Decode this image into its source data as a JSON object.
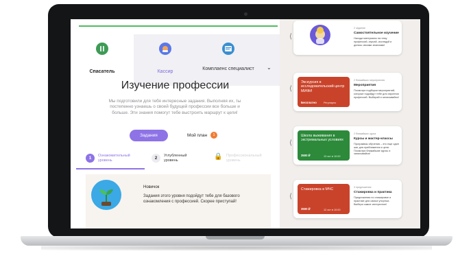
{
  "tabs": [
    {
      "label": "Спасатель",
      "icon": "lifeguard-icon",
      "color": "#3e9b56"
    },
    {
      "label": "Кассир",
      "icon": "cashier-icon",
      "color": "#5a78e8"
    },
    {
      "label": "Комплаенс специалист",
      "icon": "compliance-icon",
      "color": "#3a8fd0"
    }
  ],
  "main": {
    "title": "Изучение профессии",
    "description": "Мы подготовили для тебя интересные задания. Выполняя их, ты постепенно узнаешь о своей будущей профессии все больше и больше. Эти знания помогут тебе выстроить маршрут к цели!",
    "tasks_button": "Задания",
    "my_plan": "Мой план",
    "plan_count": "1"
  },
  "levels": [
    {
      "num": "1",
      "label": "Ознакомительный уровень"
    },
    {
      "num": "2",
      "label": "Углубленный уровень"
    },
    {
      "label": "Профессиональный уровень"
    }
  ],
  "level_card": {
    "name": "Новичок",
    "text": "Задания этого уровня подойдут тебе для базового ознакомления с профессией. Скорее приступай!"
  },
  "cards": [
    {
      "kicker": "2 задания",
      "title": "Самостоятельное изучение",
      "desc": "Находи материалы на тему профессий, изучай, исследуй и делись своими знаниями!"
    },
    {
      "img_title": "Экскурсия в исследовательский центр МИФИ",
      "img_price": "Бесплатно",
      "img_date": "Регулярно",
      "kicker": "2 ближайших мероприятия",
      "title": "Мероприятия",
      "desc": "Посмотри подборки мероприятий, которые подойдут тебе для изучения профессий. Выбирай и записывайся!",
      "color": "#c9432a"
    },
    {
      "img_title": "Школа выживания в экстремальных условиях",
      "img_price": "3500 ₽",
      "img_date": "13 окт в 10:00",
      "kicker": "2 ближайших курса",
      "title": "Курсы и мастер-классы",
      "desc": "Программы обучения – это еще один шаг для приближения к цели. Посмотри ближайшие курсы и записывайся!",
      "color": "#2c8a3a"
    },
    {
      "img_title": "Стажировка в МЧС",
      "img_price": "3500 ₽",
      "img_date": "12 окт в 10:00",
      "kicker": "3 предложения",
      "title": "Стажировка и практика",
      "desc": "Предложения по стажировке и практике для самых упорных. Выбери самое интересное!",
      "color": "#c9432a"
    }
  ]
}
